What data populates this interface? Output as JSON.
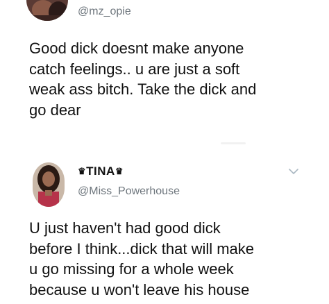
{
  "tweets": [
    {
      "handle": "@mz_opie",
      "lines": [
        "Good dick doesnt make anyone",
        "catch feelings.. u are just a soft",
        "weak ass bitch. Take the dick and",
        "go dear"
      ]
    },
    {
      "display_name": "TINA",
      "name_decoration_icon": "crown-emoji",
      "handle": "@Miss_Powerhouse",
      "lines": [
        "U just haven't had good dick",
        "before I think...dick that will make",
        "u go missing for a whole week",
        "because u won't leave his house"
      ],
      "menu_icon": "chevron-down-icon"
    }
  ],
  "colors": {
    "text": "#111111",
    "handle": "#6e767d",
    "chevron": "#aab8c2"
  }
}
